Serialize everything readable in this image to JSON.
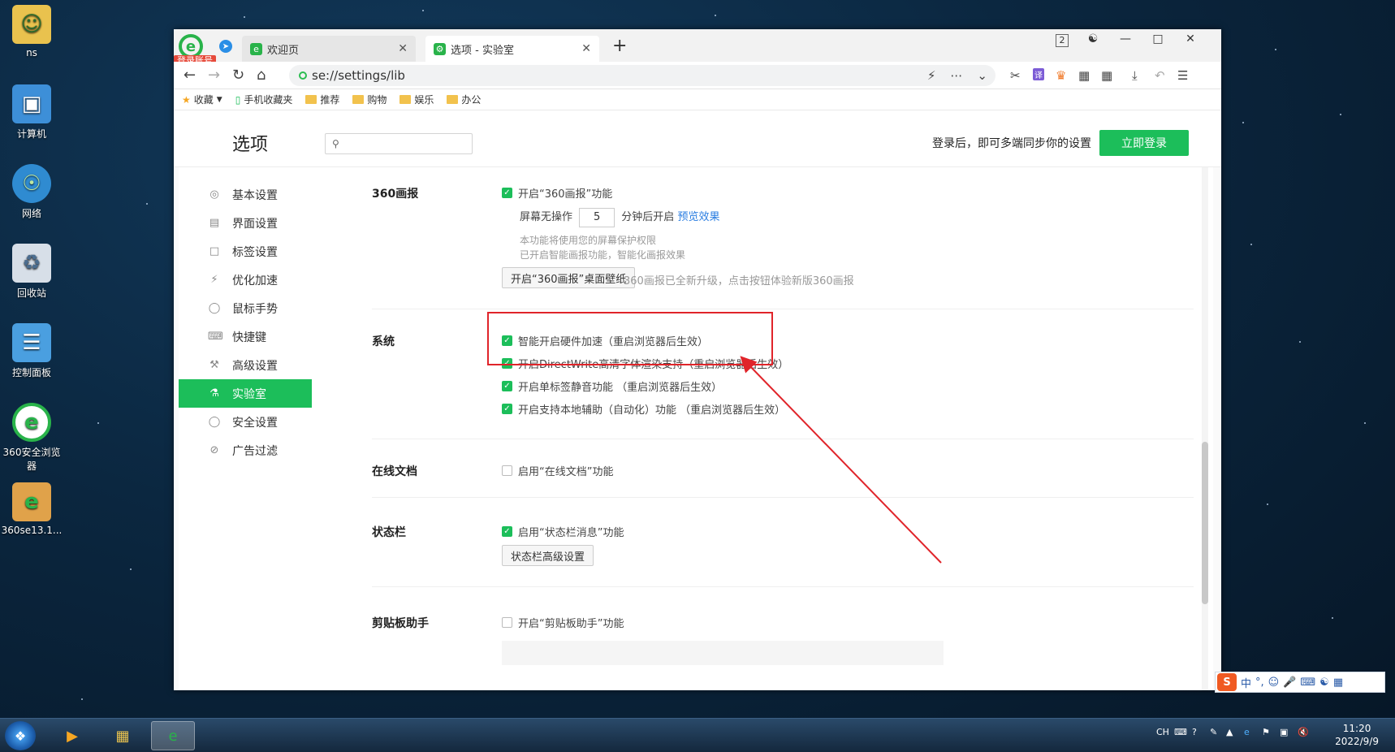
{
  "desktop": {
    "icons": [
      {
        "label": "ns",
        "icon": "user-folder-icon"
      },
      {
        "label": "计算机",
        "icon": "computer-icon"
      },
      {
        "label": "网络",
        "icon": "network-icon"
      },
      {
        "label": "回收站",
        "icon": "recycle-bin-icon"
      },
      {
        "label": "控制面板",
        "icon": "control-panel-icon"
      },
      {
        "label": "360安全浏览器",
        "icon": "360-browser-icon"
      },
      {
        "label": "360se13.1...",
        "icon": "installer-icon"
      }
    ]
  },
  "browser": {
    "login_badge": "登录账号",
    "tabs": [
      {
        "title": "欢迎页",
        "icon": "360-favicon",
        "active": false
      },
      {
        "title": "选项 - 实验室",
        "icon": "settings-favicon",
        "active": true
      }
    ],
    "new_tab": "+",
    "tab_count": "2",
    "url": "se://settings/lib",
    "bookmarks": [
      {
        "label": "收藏",
        "icon": "star-icon"
      },
      {
        "label": "手机收藏夹",
        "icon": "phone-icon"
      },
      {
        "label": "推荐",
        "icon": "folder-icon"
      },
      {
        "label": "购物",
        "icon": "folder-icon"
      },
      {
        "label": "娱乐",
        "icon": "folder-icon"
      },
      {
        "label": "办公",
        "icon": "folder-icon"
      }
    ]
  },
  "settings": {
    "page_title": "选项",
    "search_placeholder": "",
    "login_hint": "登录后，即可多端同步你的设置",
    "login_button": "立即登录",
    "sidebar": [
      {
        "label": "基本设置",
        "icon": "settings-circle-icon",
        "active": false
      },
      {
        "label": "界面设置",
        "icon": "window-icon",
        "active": false
      },
      {
        "label": "标签设置",
        "icon": "tab-icon",
        "active": false
      },
      {
        "label": "优化加速",
        "icon": "lightning-icon",
        "active": false
      },
      {
        "label": "鼠标手势",
        "icon": "mouse-icon",
        "active": false
      },
      {
        "label": "快捷键",
        "icon": "keyboard-icon",
        "active": false
      },
      {
        "label": "高级设置",
        "icon": "wrench-icon",
        "active": false
      },
      {
        "label": "实验室",
        "icon": "flask-icon",
        "active": true
      },
      {
        "label": "安全设置",
        "icon": "shield-icon",
        "active": false
      },
      {
        "label": "广告过滤",
        "icon": "block-icon",
        "active": false
      }
    ],
    "sections": {
      "huabao": {
        "title": "360画报",
        "enable": {
          "label": "开启“360画报”功能",
          "checked": true
        },
        "idle_prefix": "屏幕无操作",
        "idle_value": "5",
        "idle_suffix": "分钟后开启",
        "preview_link": "预览效果",
        "note1": "本功能将使用您的屏幕保护权限",
        "note2": "已开启智能画报功能，智能化画报效果",
        "wallpaper_button": "开启“360画报”桌面壁纸",
        "wallpaper_note": "360画报已全新升级，点击按钮体验新版360画报"
      },
      "system": {
        "title": "系统",
        "options": [
          {
            "label": "智能开启硬件加速（重启浏览器后生效）",
            "checked": true
          },
          {
            "label": "开启DirectWrite高清字体渲染支持（重启浏览器后生效）",
            "checked": true
          },
          {
            "label": "开启单标签静音功能 （重启浏览器后生效）",
            "checked": true
          },
          {
            "label": "开启支持本地辅助（自动化）功能 （重启浏览器后生效）",
            "checked": true
          }
        ]
      },
      "online_docs": {
        "title": "在线文档",
        "option": {
          "label": "启用“在线文档”功能",
          "checked": false
        }
      },
      "statusbar": {
        "title": "状态栏",
        "option": {
          "label": "启用“状态栏消息”功能",
          "checked": true
        },
        "button": "状态栏高级设置"
      },
      "clipboard": {
        "title": "剪贴板助手",
        "option": {
          "label": "开启“剪贴板助手”功能",
          "checked": false
        }
      }
    }
  },
  "ime": {
    "lang": "中",
    "punct": "°,"
  },
  "taskbar": {
    "lang": "CH",
    "time": "11:20",
    "date": "2022/9/9"
  },
  "colors": {
    "accent": "#1cbe5a",
    "annotation": "#e0242a"
  }
}
